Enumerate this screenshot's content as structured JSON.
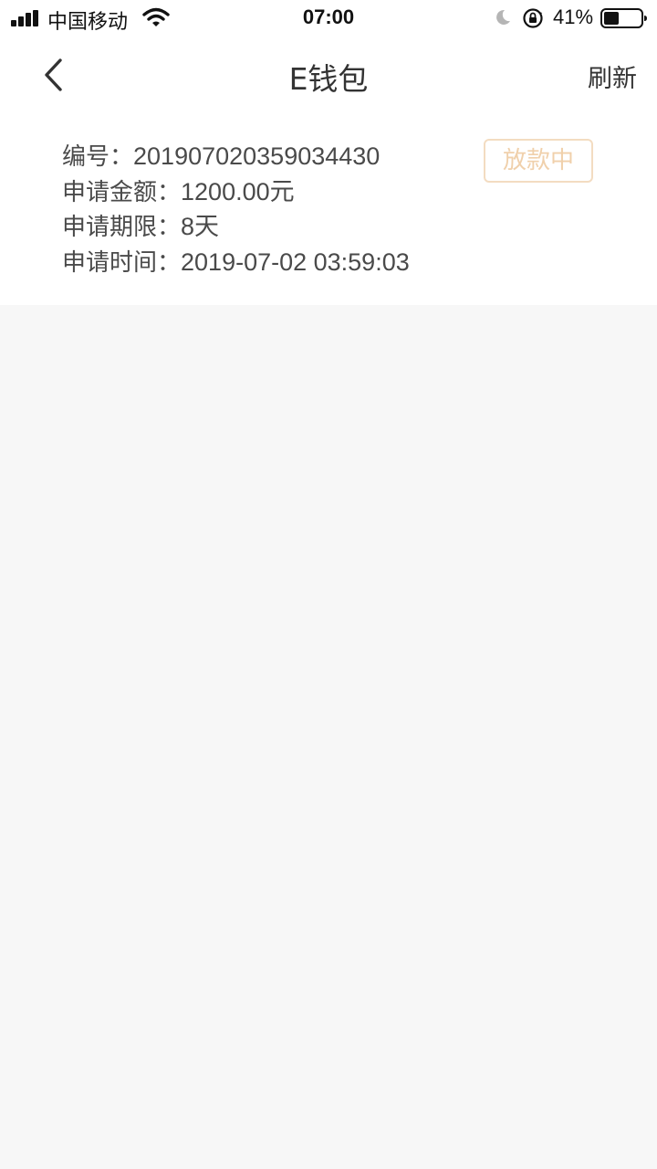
{
  "status_bar": {
    "carrier": "中国移动",
    "time": "07:00",
    "battery_percent": "41%",
    "battery_level": 0.41,
    "icons": [
      "signal-icon",
      "wifi-icon",
      "moon-icon",
      "rotation-lock-icon",
      "battery-icon"
    ]
  },
  "nav": {
    "title": "E钱包",
    "refresh_label": "刷新",
    "back_icon": "chevron-left-icon"
  },
  "record": {
    "number_label": "编号：",
    "number_value": "201907020359034430",
    "amount_label": "申请金额：",
    "amount_value": "1200.00元",
    "term_label": "申请期限：",
    "term_value": "8天",
    "time_label": "申请时间：",
    "time_value": "2019-07-02 03:59:03",
    "status": "放款中"
  },
  "colors": {
    "background": "#f7f7f7",
    "card": "#ffffff",
    "text": "#4a4a4a",
    "status_border": "#f3dcc1",
    "status_text": "#f0d0ab"
  }
}
